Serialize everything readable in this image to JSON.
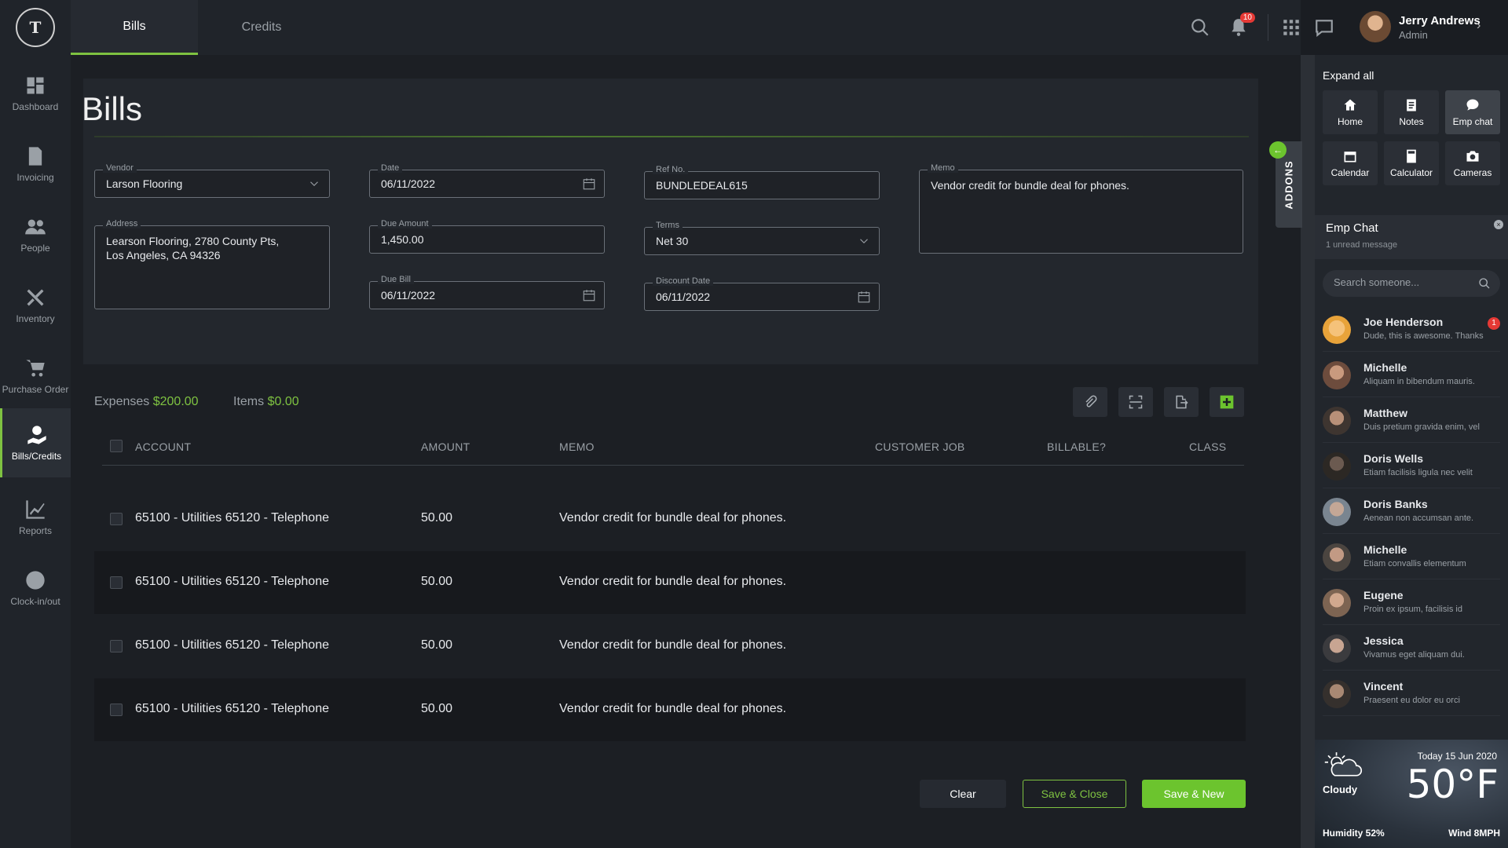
{
  "app": {
    "logo_text": "T"
  },
  "sidebar": {
    "items": [
      {
        "label": "Dashboard"
      },
      {
        "label": "Invoicing"
      },
      {
        "label": "People"
      },
      {
        "label": "Inventory"
      },
      {
        "label": "Purchase Order"
      },
      {
        "label": "Bills/Credits"
      },
      {
        "label": "Reports"
      },
      {
        "label": "Clock-in/out"
      }
    ]
  },
  "header": {
    "tabs": [
      {
        "label": "Bills"
      },
      {
        "label": "Credits"
      }
    ],
    "notifications_count": "10",
    "user": {
      "name": "Jerry Andrews",
      "role": "Admin"
    }
  },
  "form": {
    "title": "Bills",
    "vendor": {
      "label": "Vendor",
      "value": "Larson Flooring"
    },
    "address": {
      "label": "Address",
      "value": "Learson Flooring, 2780 County Pts,\nLos Angeles, CA 94326"
    },
    "date": {
      "label": "Date",
      "value": "06/11/2022"
    },
    "due_amount": {
      "label": "Due Amount",
      "value": "1,450.00"
    },
    "due_bill": {
      "label": "Due Bill",
      "value": "06/11/2022"
    },
    "ref_no": {
      "label": "Ref No.",
      "value": "BUNDLEDEAL615"
    },
    "terms": {
      "label": "Terms",
      "value": "Net 30"
    },
    "discount_date": {
      "label": "Discount Date",
      "value": "06/11/2022"
    },
    "memo": {
      "label": "Memo",
      "value": "Vendor credit for bundle deal for phones."
    }
  },
  "summary": {
    "expenses_label": "Expenses",
    "expenses_amount": "$200.00",
    "items_label": "Items",
    "items_amount": "$0.00"
  },
  "table": {
    "headers": [
      "ACCOUNT",
      "AMOUNT",
      "MEMO",
      "CUSTOMER JOB",
      "BILLABLE?",
      "CLASS"
    ],
    "rows": [
      {
        "account": "65100 - Utilities 65120 - Telephone",
        "amount": "50.00",
        "memo": "Vendor credit for bundle deal for phones."
      },
      {
        "account": "65100 - Utilities 65120 - Telephone",
        "amount": "50.00",
        "memo": "Vendor credit for bundle deal for phones."
      },
      {
        "account": "65100 - Utilities 65120 - Telephone",
        "amount": "50.00",
        "memo": "Vendor credit for bundle deal for phones."
      },
      {
        "account": "65100 - Utilities 65120 - Telephone",
        "amount": "50.00",
        "memo": "Vendor credit for bundle deal for phones."
      }
    ]
  },
  "actions": {
    "clear": "Clear",
    "save_close": "Save & Close",
    "save_new": "Save & New"
  },
  "addons": {
    "tab_label": "ADDONS",
    "expand_all": "Expand all",
    "items": [
      {
        "label": "Home",
        "icon": "home-icon"
      },
      {
        "label": "Notes",
        "icon": "notes-icon"
      },
      {
        "label": "Emp chat",
        "icon": "chat-icon"
      },
      {
        "label": "Calendar",
        "icon": "calendar-icon"
      },
      {
        "label": "Calculator",
        "icon": "calculator-icon"
      },
      {
        "label": "Cameras",
        "icon": "camera-icon"
      }
    ]
  },
  "chat": {
    "title": "Emp Chat",
    "subtitle": "1 unread message",
    "search_placeholder": "Search someone...",
    "contacts": [
      {
        "name": "Joe Henderson",
        "message": "Dude, this is awesome. Thanks",
        "unread": "1"
      },
      {
        "name": "Michelle",
        "message": "Aliquam in bibendum mauris."
      },
      {
        "name": "Matthew",
        "message": "Duis pretium gravida enim, vel"
      },
      {
        "name": "Doris Wells",
        "message": "Etiam facilisis ligula nec velit"
      },
      {
        "name": "Doris Banks",
        "message": "Aenean non accumsan ante."
      },
      {
        "name": "Michelle",
        "message": "Etiam convallis elementum"
      },
      {
        "name": "Eugene",
        "message": "Proin ex ipsum, facilisis id"
      },
      {
        "name": "Jessica",
        "message": "Vivamus eget aliquam dui."
      },
      {
        "name": "Vincent",
        "message": "Praesent eu dolor eu orci"
      }
    ]
  },
  "weather": {
    "condition": "Cloudy",
    "date": "Today 15 Jun 2020",
    "temp": "50°F",
    "humidity": "Humidity 52%",
    "wind": "Wind 8MPH"
  },
  "colors": {
    "accent": "#7ec241",
    "badge": "#e53935"
  }
}
